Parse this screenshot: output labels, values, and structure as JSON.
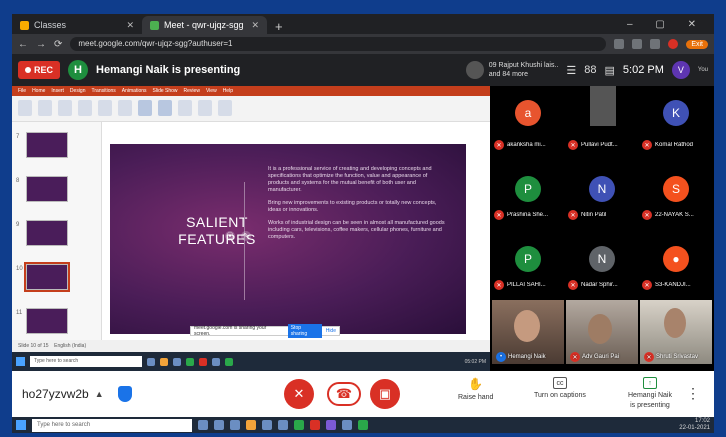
{
  "browser": {
    "tabs": [
      {
        "label": "Classes"
      },
      {
        "label": "Meet - qwr-ujqz-sgg"
      }
    ],
    "url": "meet.google.com/qwr-ujqz-sgg?authuser=1",
    "exit_label": "Exit",
    "icons": [
      "back-arrow-icon",
      "forward-arrow-icon",
      "reload-icon",
      "close-icon",
      "plus-icon"
    ]
  },
  "meet": {
    "rec_label": "REC",
    "presenter_initial": "H",
    "presenter_title": "Hemangi Naik is presenting",
    "others_line1": "09 Rajput Khushi lais..",
    "others_line2": "and 84 more",
    "count": "88",
    "clock": "5:02 PM",
    "you_initial": "V",
    "you_label": "You"
  },
  "presentation": {
    "slide_title_line1": "SALIENT",
    "slide_title_line2": "FEATURES",
    "slide_paragraphs": [
      "It is a professional service of creating and developing concepts and specifications that optimize the function, value and appearance of products and systems for the mutual benefit of both user and manufacturer.",
      "Bring new improvements to existing products or totally new concepts, ideas or innovations.",
      "Works of industrial design can be seen in almost all manufactured goods including cars, televisions, coffee makers, cellular phones, furniture and computers."
    ],
    "thumb_numbers": [
      "7",
      "8",
      "9",
      "10",
      "11"
    ],
    "status_left": "Slide 10 of 15",
    "status_notes": "English (India)",
    "sharing_banner": "meet.google.com is sharing your screen.",
    "stop_sharing": "Stop sharing",
    "hide": "Hide",
    "taskbar_search": "Type here to search",
    "taskbar_time": "05:02 PM",
    "ribbon_tabs": [
      "File",
      "Home",
      "Insert",
      "Design",
      "Transitions",
      "Animations",
      "Slide Show",
      "Review",
      "View",
      "Help"
    ]
  },
  "participants": [
    {
      "initial": "a",
      "name": "akanksha mi...",
      "color": "#e8542e"
    },
    {
      "initial": "",
      "name": "Pullavi Pudt...",
      "color": "#444444"
    },
    {
      "initial": "K",
      "name": "Komal Rathod",
      "color": "#3f51b5"
    },
    {
      "initial": "P",
      "name": "Prashina She...",
      "color": "#1e8e3e"
    },
    {
      "initial": "N",
      "name": "Nitin Patil",
      "color": "#3f51b5"
    },
    {
      "initial": "S",
      "name": "22-NAYAK S...",
      "color": "#f4511e"
    },
    {
      "initial": "P",
      "name": "PILLAI SAHI...",
      "color": "#1e8e3e"
    },
    {
      "initial": "N",
      "name": "Nadar Sphir...",
      "color": "#5f6368"
    },
    {
      "initial": "",
      "name": "S3-KANDJI...",
      "color": "#c2185b"
    }
  ],
  "video_tiles": [
    {
      "name": "Hemangi Naik"
    },
    {
      "name": "Adv Gauri Pai"
    },
    {
      "name": "Shruti Srivastav"
    }
  ],
  "bottom": {
    "meeting_code": "ho27yzvw2b",
    "raise_hand": "Raise hand",
    "captions": "Turn on captions",
    "presenting_line1": "Hemangi Naik",
    "presenting_line2": "is presenting"
  },
  "windows_taskbar": {
    "search": "Type here to search",
    "time": "17:02",
    "date": "22-01-2021"
  }
}
